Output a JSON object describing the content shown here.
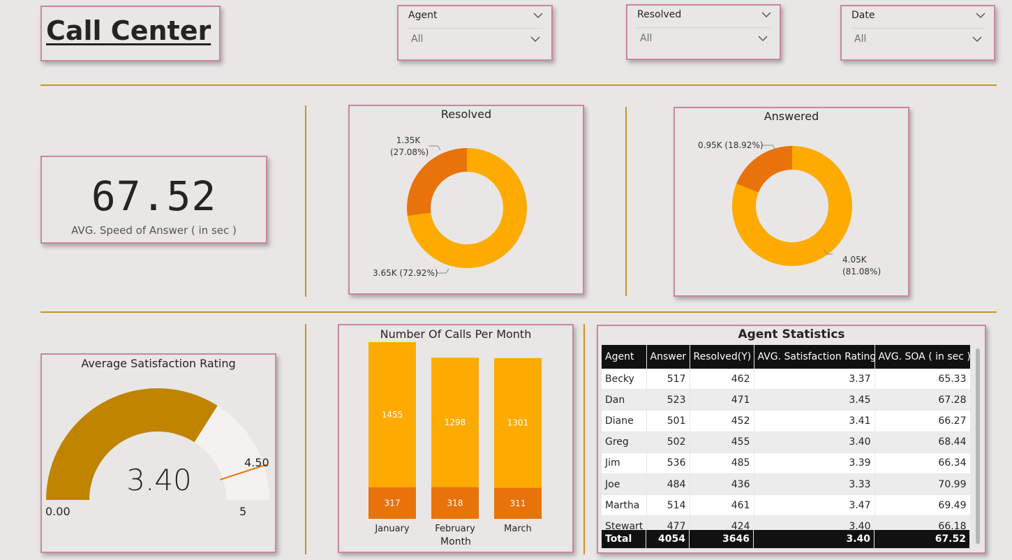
{
  "header": {
    "title": "Call Center"
  },
  "slicers": [
    {
      "label": "Agent",
      "value": "All"
    },
    {
      "label": "Resolved",
      "value": "All"
    },
    {
      "label": "Date",
      "value": "All"
    }
  ],
  "kpi": {
    "value": "67.52",
    "label": "AVG. Speed of Answer ( in sec )"
  },
  "chart_data": [
    {
      "type": "pie",
      "title": "Resolved",
      "slices": [
        {
          "label": "1.35K",
          "pct": "(27.08%)",
          "value": 1350,
          "percent": 27.08,
          "color": "#e8730a"
        },
        {
          "label": "3.65K (72.92%)",
          "value": 3650,
          "percent": 72.92,
          "color": "#fdab00"
        }
      ]
    },
    {
      "type": "pie",
      "title": "Answered",
      "slices": [
        {
          "label": "0.95K (18.92%)",
          "value": 950,
          "percent": 18.92,
          "color": "#e8730a"
        },
        {
          "label": "4.05K",
          "pct": "(81.08%)",
          "value": 4050,
          "percent": 81.08,
          "color": "#fdab00"
        }
      ]
    },
    {
      "type": "gauge",
      "title": "Average Satisfaction Rating",
      "value": 3.4,
      "value_label": "3.40",
      "min": 0,
      "min_label": "0.00",
      "max": 5,
      "max_label": "5",
      "target": 4.5,
      "target_label": "4.50",
      "fill_color": "#c08400",
      "track_color": "#f3f2f1",
      "target_color": "#e8730a"
    },
    {
      "type": "bar",
      "title": "Number Of Calls Per Month",
      "xlabel": "Month",
      "categories": [
        "January",
        "February",
        "March"
      ],
      "series": [
        {
          "values": [
            317,
            318,
            311
          ],
          "color": "#e8730a"
        },
        {
          "values": [
            1455,
            1298,
            1301
          ],
          "color": "#fdab00"
        }
      ],
      "ylim": [
        0,
        1900
      ]
    }
  ],
  "agent_table": {
    "title": "Agent Statistics",
    "columns": [
      "Agent",
      "Answer",
      "Resolved(Y)",
      "AVG. Satisfaction Rating",
      "AVG. SOA ( in sec )"
    ],
    "rows": [
      [
        "Becky",
        "517",
        "462",
        "3.37",
        "65.33"
      ],
      [
        "Dan",
        "523",
        "471",
        "3.45",
        "67.28"
      ],
      [
        "Diane",
        "501",
        "452",
        "3.41",
        "66.27"
      ],
      [
        "Greg",
        "502",
        "455",
        "3.40",
        "68.44"
      ],
      [
        "Jim",
        "536",
        "485",
        "3.39",
        "66.34"
      ],
      [
        "Joe",
        "484",
        "436",
        "3.33",
        "70.99"
      ],
      [
        "Martha",
        "514",
        "461",
        "3.47",
        "69.49"
      ],
      [
        "Stewart",
        "477",
        "424",
        "3.40",
        "66.18"
      ]
    ],
    "total": [
      "Total",
      "4054",
      "3646",
      "3.40",
      "67.52"
    ]
  }
}
